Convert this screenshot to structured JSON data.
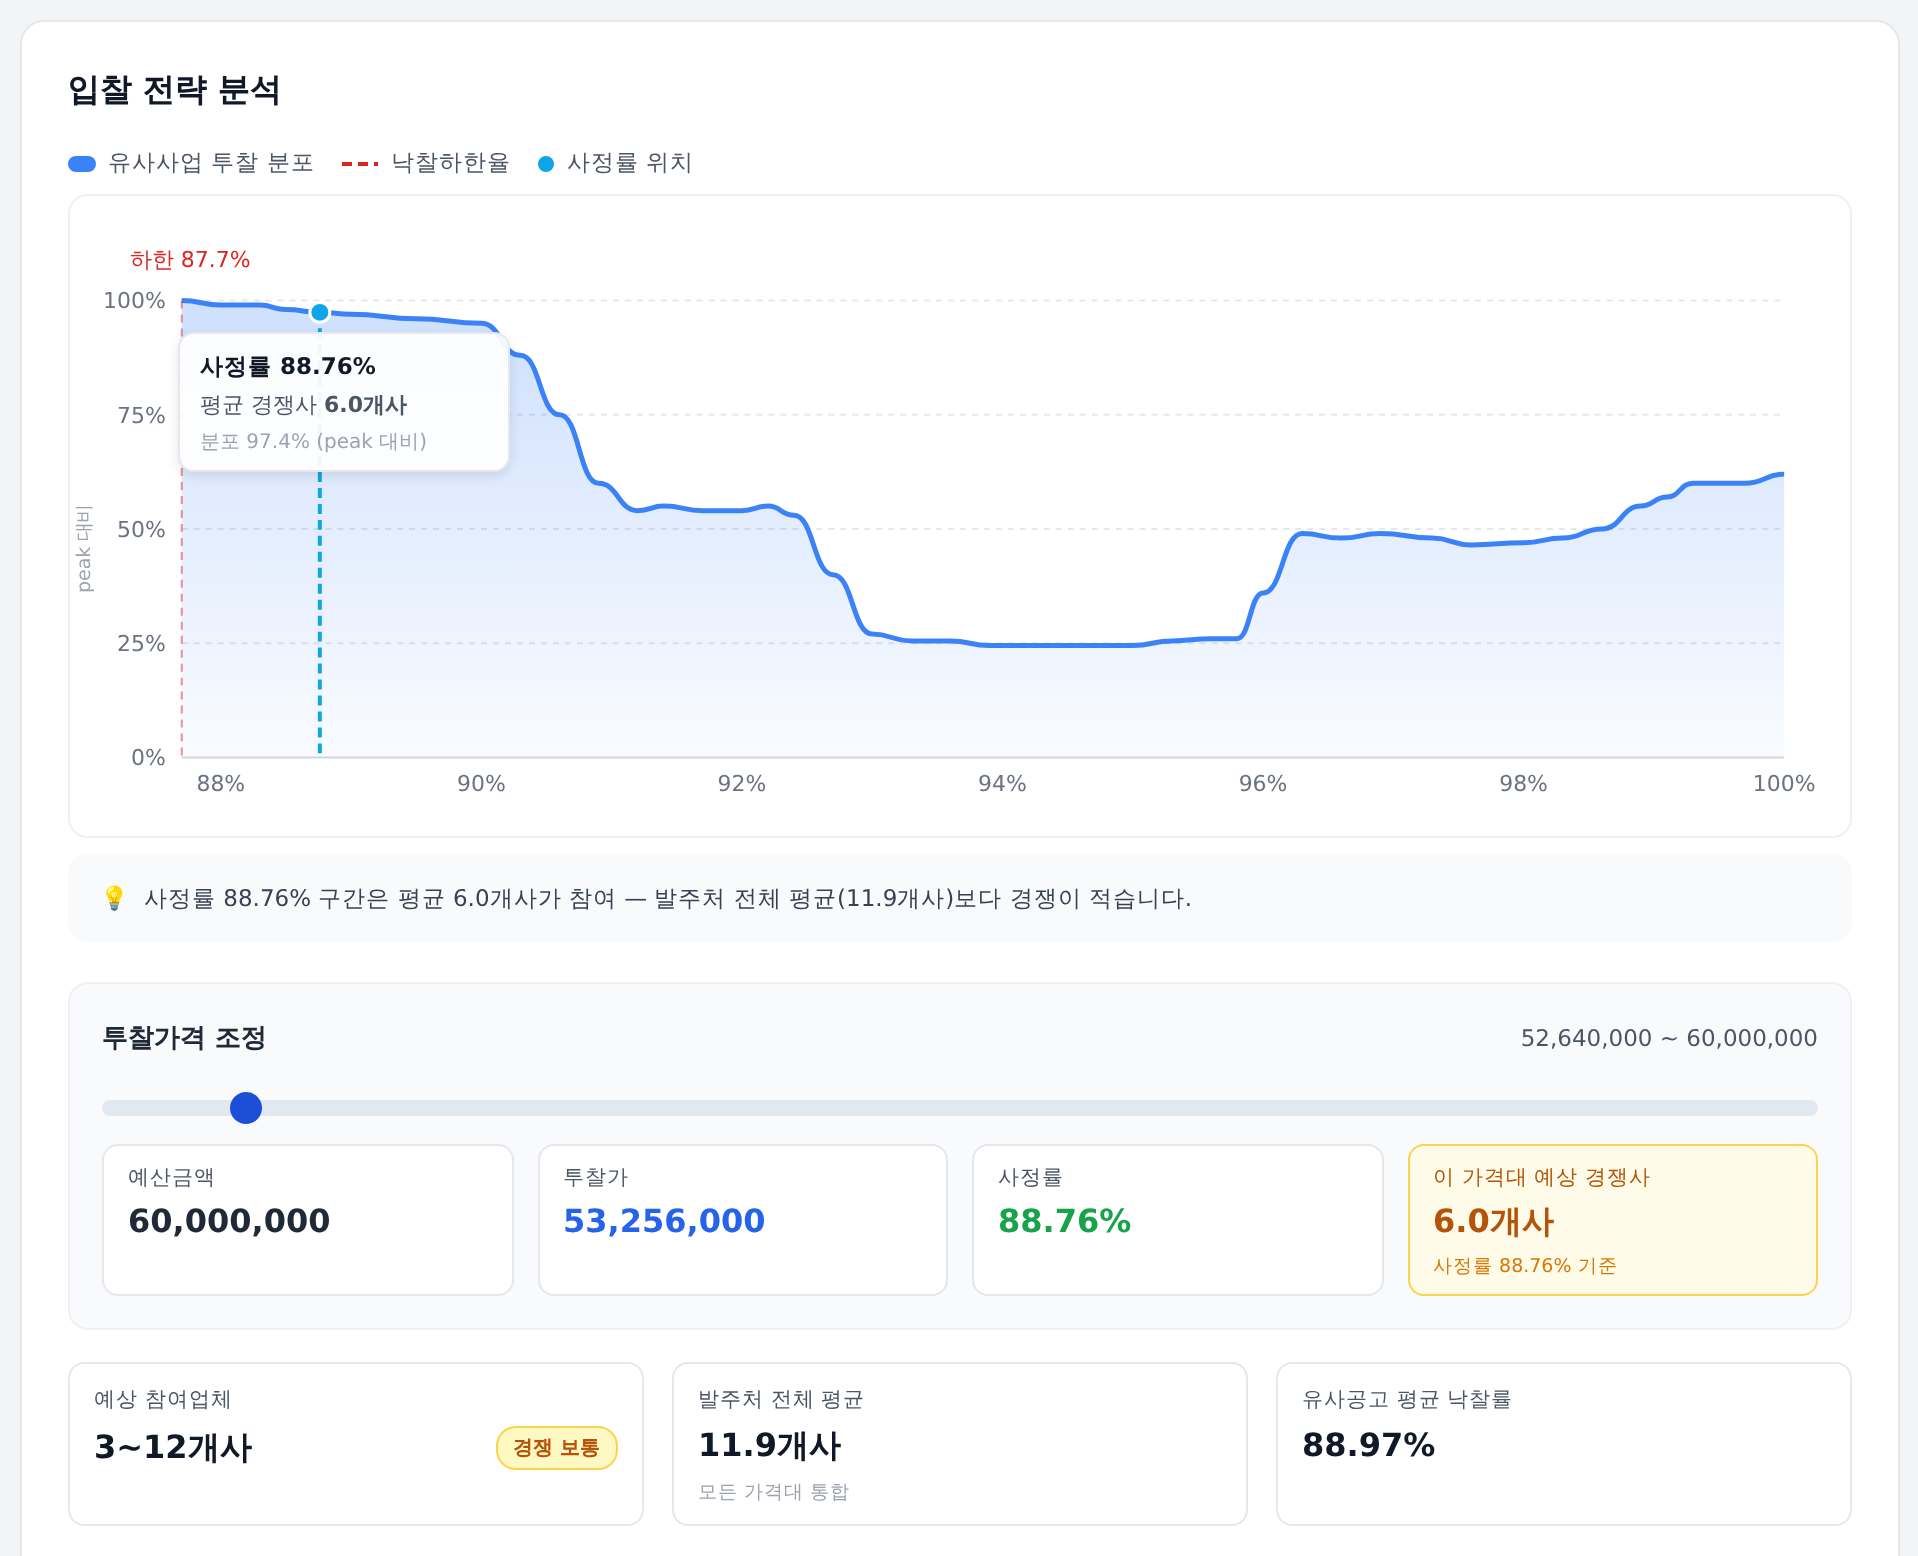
{
  "title": "입찰 전략 분석",
  "legend": [
    {
      "kind": "area"
    },
    {
      "kind": "dashed",
      "label": "낙찰하한율"
    },
    {
      "kind": "dot",
      "label": "사정률 위치"
    }
  ],
  "chart": {
    "chart_data": {
      "type": "area",
      "grid": true,
      "ylabel": "peak 대비",
      "xlim": [
        87.7,
        100
      ],
      "ylim": [
        0,
        100
      ],
      "xticks": [
        {
          "value": 88,
          "label": "88%"
        },
        {
          "value": 90,
          "label": "90%"
        },
        {
          "value": 92,
          "label": "92%"
        },
        {
          "value": 94,
          "label": "94%"
        },
        {
          "value": 96,
          "label": "96%"
        },
        {
          "value": 98,
          "label": "98%"
        },
        {
          "value": 100,
          "label": "100%"
        }
      ],
      "yticks": [
        {
          "value": 0,
          "label": "0%"
        },
        {
          "value": 25,
          "label": "25%"
        },
        {
          "value": 50,
          "label": "50%"
        },
        {
          "value": 75,
          "label": "75%"
        },
        {
          "value": 100,
          "label": "100%"
        }
      ],
      "x": [
        87.7,
        88,
        88.3,
        88.5,
        88.76,
        89,
        89.5,
        90,
        90.3,
        90.6,
        90.9,
        91.2,
        91.4,
        91.7,
        92,
        92.2,
        92.4,
        92.7,
        93,
        93.3,
        93.6,
        93.9,
        94.5,
        95,
        95.3,
        95.6,
        95.8,
        96,
        96.3,
        96.6,
        96.9,
        97.3,
        97.6,
        98,
        98.3,
        98.6,
        98.9,
        99.1,
        99.3,
        99.7,
        100
      ],
      "series": [
        {
          "name": "유사사업 투찰 분포",
          "color": "#3b82f6",
          "values": [
            100,
            99,
            99,
            98,
            97.4,
            97,
            96,
            95,
            88,
            75,
            60,
            54,
            55,
            54,
            54,
            55,
            53,
            40,
            27,
            25.5,
            25.5,
            24.5,
            24.5,
            24.5,
            25.5,
            26,
            26,
            36,
            49,
            48,
            49,
            48,
            46.5,
            47,
            48,
            50,
            55,
            57,
            60,
            60,
            62
          ]
        }
      ],
      "ref_lines": [
        {
          "axis": "x",
          "value": 87.7,
          "label": "하한 87.7%"
        },
        {
          "axis": "x",
          "value": 88.76
        }
      ]
    },
    "tooltip": {
      "title": "사정률 88.76%",
      "line_label": "평균 경쟁사",
      "line_value": "6.0개사",
      "note": "분포 97.4% (peak 대비)"
    }
  },
  "insight": {
    "icon": "💡",
    "text": "사정률 88.76% 구간은 평균 6.0개사가 참여 — 발주처 전체 평균(11.9개사)보다 경쟁이 적습니다."
  },
  "price_panel": {
    "title": "투찰가격 조정",
    "range": "52,640,000 ~ 60,000,000",
    "level": 0.084,
    "cards": [
      {
        "kind": "plain",
        "label": "예산금액",
        "value": "60,000,000",
        "color": "#1f2937"
      },
      {
        "kind": "plain",
        "label": "투찰가",
        "value": "53,256,000",
        "color": "#2563eb"
      },
      {
        "kind": "plain",
        "label": "사정률",
        "value": "88.76%",
        "color": "#16a34a"
      },
      {
        "kind": "highlight",
        "label": "이 가격대 예상 경쟁사",
        "value": "6.0개사",
        "color": "#b45309",
        "note": "사정률 88.76% 기준"
      }
    ]
  },
  "summary": [
    {
      "label": "예상 참여업체",
      "value": "3~12개사",
      "badge": "경쟁 보통"
    },
    {
      "label": "발주처 전체 평균",
      "value": "11.9개사",
      "note": "모든 가격대 통합"
    },
    {
      "label": "유사공고 평균 낙찰률",
      "value": "88.97%"
    }
  ]
}
